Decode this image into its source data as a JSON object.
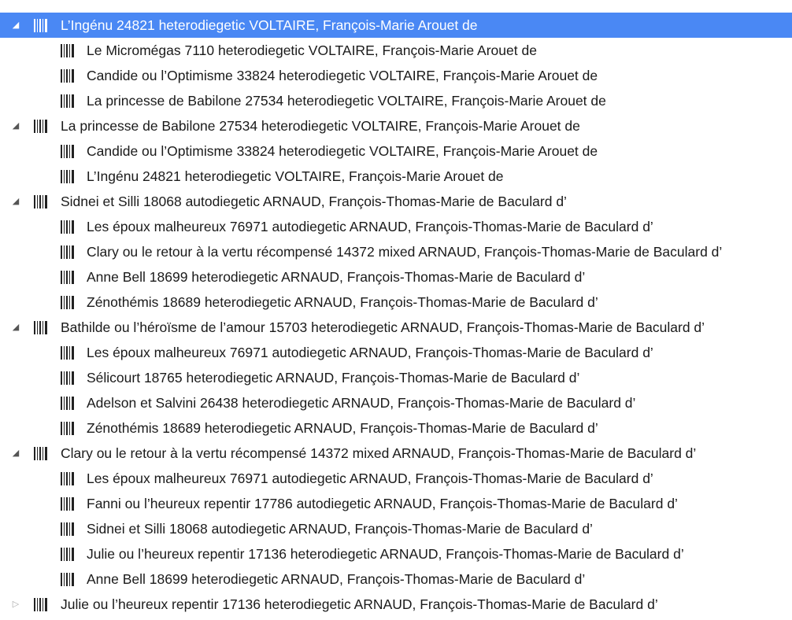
{
  "tree": {
    "groups": [
      {
        "label": "L’Ingénu 24821 heterodiegetic VOLTAIRE, François-Marie Arouet de",
        "expanded": true,
        "selected": true,
        "children": [
          "Le Micromégas 7110 heterodiegetic VOLTAIRE, François-Marie Arouet de",
          "Candide ou l’Optimisme 33824 heterodiegetic VOLTAIRE, François-Marie Arouet de",
          "La princesse de Babilone 27534 heterodiegetic VOLTAIRE, François-Marie Arouet de"
        ]
      },
      {
        "label": "La princesse de Babilone 27534 heterodiegetic VOLTAIRE, François-Marie Arouet de",
        "expanded": true,
        "selected": false,
        "children": [
          "Candide ou l’Optimisme 33824 heterodiegetic VOLTAIRE, François-Marie Arouet de",
          "L’Ingénu 24821 heterodiegetic VOLTAIRE, François-Marie Arouet de"
        ]
      },
      {
        "label": "Sidnei et Silli 18068 autodiegetic ARNAUD, François-Thomas-Marie de Baculard d’",
        "expanded": true,
        "selected": false,
        "children": [
          "Les époux malheureux 76971 autodiegetic ARNAUD, François-Thomas-Marie de Baculard d’",
          "Clary ou le retour à la vertu récompensé 14372 mixed ARNAUD, François-Thomas-Marie de Baculard d’",
          "Anne Bell 18699 heterodiegetic ARNAUD, François-Thomas-Marie de Baculard d’",
          "Zénothémis 18689 heterodiegetic ARNAUD, François-Thomas-Marie de Baculard d’"
        ]
      },
      {
        "label": "Bathilde ou l’héroïsme de l’amour 15703 heterodiegetic ARNAUD, François-Thomas-Marie de Baculard d’",
        "expanded": true,
        "selected": false,
        "children": [
          "Les époux malheureux 76971 autodiegetic ARNAUD, François-Thomas-Marie de Baculard d’",
          "Sélicourt 18765 heterodiegetic ARNAUD, François-Thomas-Marie de Baculard d’",
          "Adelson et Salvini 26438 heterodiegetic ARNAUD, François-Thomas-Marie de Baculard d’",
          "Zénothémis 18689 heterodiegetic ARNAUD, François-Thomas-Marie de Baculard d’"
        ]
      },
      {
        "label": "Clary ou le retour à la vertu récompensé 14372 mixed ARNAUD, François-Thomas-Marie de Baculard d’",
        "expanded": true,
        "selected": false,
        "children": [
          "Les époux malheureux 76971 autodiegetic ARNAUD, François-Thomas-Marie de Baculard d’",
          "Fanni ou l’heureux repentir 17786 autodiegetic ARNAUD, François-Thomas-Marie de Baculard d’",
          "Sidnei et Silli 18068 autodiegetic ARNAUD, François-Thomas-Marie de Baculard d’",
          "Julie ou l’heureux repentir 17136 heterodiegetic ARNAUD, François-Thomas-Marie de Baculard d’",
          "Anne Bell 18699 heterodiegetic ARNAUD, François-Thomas-Marie de Baculard d’"
        ]
      },
      {
        "label": "Julie ou l’heureux repentir 17136 heterodiegetic ARNAUD, François-Thomas-Marie de Baculard d’",
        "expanded": false,
        "selected": false,
        "children": []
      }
    ],
    "icons": {
      "expanded": "triangle-expanded-icon",
      "collapsed": "triangle-collapsed-icon",
      "item": "barcode-icon"
    },
    "colors": {
      "selection": "#4a88f4",
      "text": "#1a1a1a",
      "selected_text": "#ffffff"
    }
  }
}
